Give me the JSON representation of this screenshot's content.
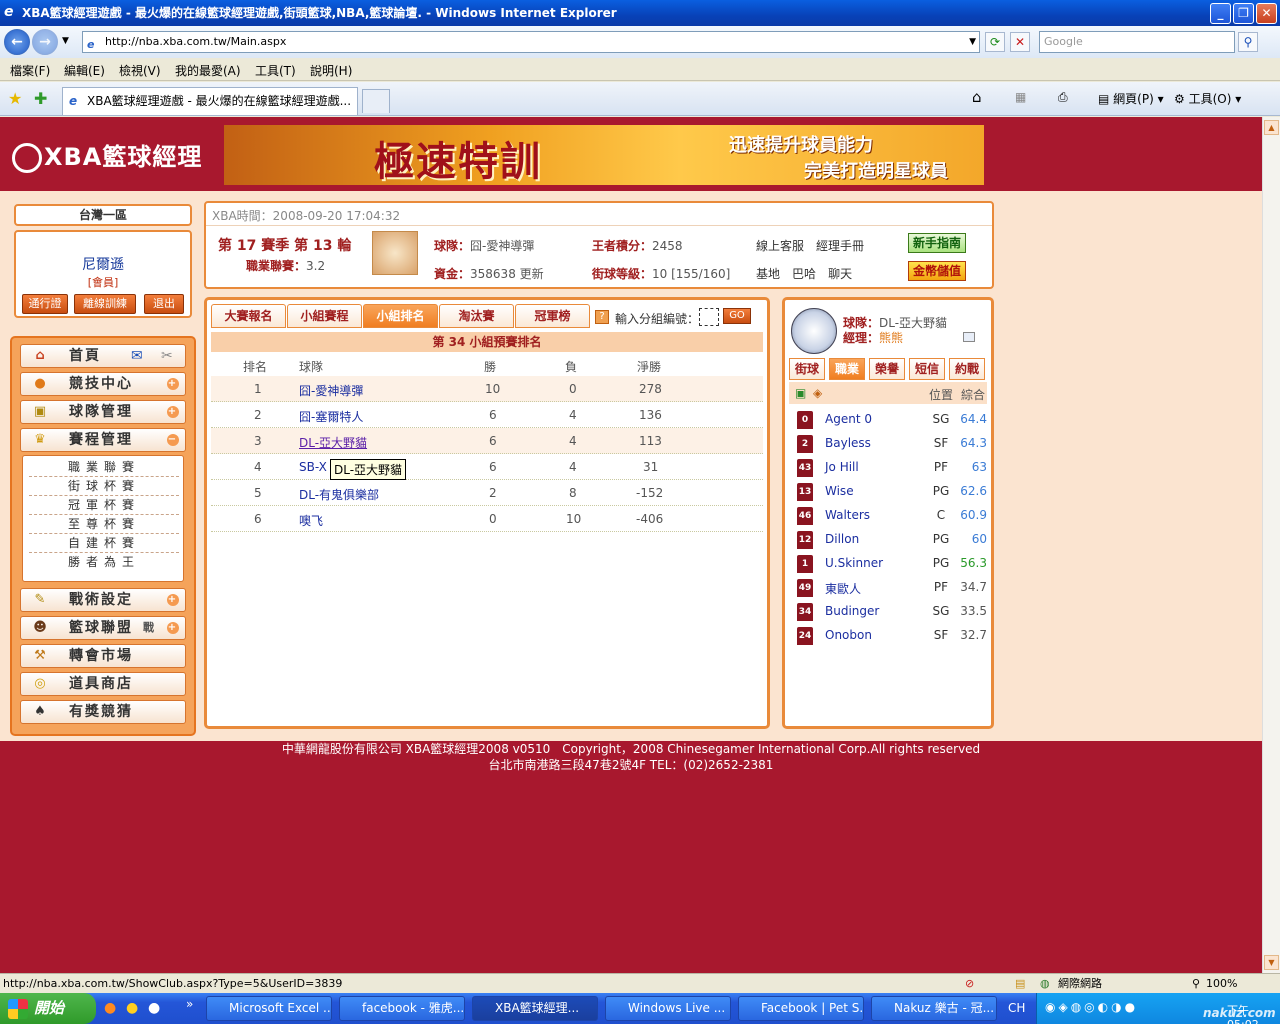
{
  "window": {
    "title": "XBA籃球經理遊戲 - 最火爆的在線籃球經理遊戲,街頭籃球,NBA,籃球論壇. - Windows Internet Explorer",
    "url": "http://nba.xba.com.tw/Main.aspx",
    "search_placeholder": "Google",
    "status_url": "http://nba.xba.com.tw/ShowClub.aspx?Type=5&UserID=3839",
    "zone": "網際網路",
    "zoom": "100%"
  },
  "menu": [
    "檔案(F)",
    "編輯(E)",
    "檢視(V)",
    "我的最愛(A)",
    "工具(T)",
    "說明(H)"
  ],
  "tab": {
    "label": "XBA籃球經理遊戲 - 最火爆的在線籃球經理遊戲..."
  },
  "toolbar": {
    "page_label": "網頁(P)",
    "tools_label": "工具(O)"
  },
  "site": {
    "logo": "XBA籃球經理",
    "ad_title": "極速特訓",
    "ad_line1": "迅速提升球員能力",
    "ad_line2": "完美打造明星球員"
  },
  "user": {
    "server": "台灣一區",
    "name": "尼爾遜",
    "role": "[會員]",
    "buttons": [
      "通行證",
      "離線訓練",
      "退出"
    ]
  },
  "nav": {
    "home": "首頁",
    "items": [
      "競技中心",
      "球隊管理",
      "賽程管理",
      "戰術設定",
      "籃球聯盟",
      "轉會市場",
      "道具商店",
      "有獎競猜"
    ],
    "league_tag": "戰",
    "sub": [
      "職業聯賽",
      "街球杯賽",
      "冠軍杯賽",
      "至尊杯賽",
      "自建杯賽",
      "勝者為王"
    ]
  },
  "info": {
    "time_label": "XBA時間：",
    "time": "2008-09-20 17:04:32",
    "season": "第 17 賽季 第 13 輪",
    "league_label": "職業聯賽：",
    "league": "3.2",
    "team_label": "球隊：",
    "team": "囧-愛神導彈",
    "points_label": "王者積分：",
    "points": "2458",
    "funds_label": "資金：",
    "funds": "358638",
    "update": "更新",
    "level_label": "街球等級：",
    "level": "10 [155/160]",
    "service": "線上客服",
    "manual": "經理手冊",
    "base": "基地",
    "baha": "巴哈",
    "chat": "聊天",
    "guide_btn": "新手指南",
    "gold_btn": "金幣儲值"
  },
  "center": {
    "tabs": [
      "大賽報名",
      "小組賽程",
      "小組排名",
      "淘汰賽",
      "冠軍榜"
    ],
    "input_label": "輸入分組編號：",
    "go": "GO",
    "group_title": "第 34 小組預賽排名",
    "headers": [
      "排名",
      "球隊",
      "勝",
      "負",
      "淨勝"
    ],
    "rows": [
      {
        "rank": "1",
        "team": "囧-愛神導彈",
        "w": "10",
        "l": "0",
        "diff": "278"
      },
      {
        "rank": "2",
        "team": "囧-塞爾特人",
        "w": "6",
        "l": "4",
        "diff": "136"
      },
      {
        "rank": "3",
        "team": "DL-亞大野貓",
        "w": "6",
        "l": "4",
        "diff": "113"
      },
      {
        "rank": "4",
        "team": "SB-X",
        "w": "6",
        "l": "4",
        "diff": "31"
      },
      {
        "rank": "5",
        "team": "DL-有鬼俱樂部",
        "w": "2",
        "l": "8",
        "diff": "-152"
      },
      {
        "rank": "6",
        "team": "噢飞",
        "w": "0",
        "l": "10",
        "diff": "-406"
      }
    ],
    "tooltip": "DL-亞大野貓"
  },
  "right": {
    "team_label": "球隊：",
    "team": "DL-亞大野貓",
    "manager_label": "經理：",
    "manager": "熊熊",
    "tabs": [
      "街球",
      "職業",
      "榮譽",
      "短信",
      "約戰"
    ],
    "col_pos": "位置",
    "col_ovr": "綜合",
    "players": [
      {
        "num": "0",
        "name": "Agent 0",
        "pos": "SG",
        "ovr": "64.4",
        "color": "#3a7bd5"
      },
      {
        "num": "2",
        "name": "Bayless",
        "pos": "SF",
        "ovr": "64.3",
        "color": "#3a7bd5"
      },
      {
        "num": "43",
        "name": "Jo Hill",
        "pos": "PF",
        "ovr": "63",
        "color": "#3a7bd5"
      },
      {
        "num": "13",
        "name": "Wise",
        "pos": "PG",
        "ovr": "62.6",
        "color": "#3a7bd5"
      },
      {
        "num": "46",
        "name": "Walters",
        "pos": "C",
        "ovr": "60.9",
        "color": "#3a7bd5"
      },
      {
        "num": "12",
        "name": "Dillon",
        "pos": "PG",
        "ovr": "60",
        "color": "#3a7bd5"
      },
      {
        "num": "1",
        "name": "U.Skinner",
        "pos": "PG",
        "ovr": "56.3",
        "color": "#2a9a2a"
      },
      {
        "num": "49",
        "name": "東歐人",
        "pos": "PF",
        "ovr": "34.7",
        "color": "#555555"
      },
      {
        "num": "34",
        "name": "Budinger",
        "pos": "SG",
        "ovr": "33.5",
        "color": "#555555"
      },
      {
        "num": "24",
        "name": "Onobon",
        "pos": "SF",
        "ovr": "32.7",
        "color": "#555555"
      }
    ]
  },
  "footer": {
    "line1": "中華網龍股份有限公司 XBA籃球經理2008 v0510　Copyright，2008 Chinesegamer International Corp.All rights reserved",
    "line2": "台北市南港路三段47巷2號4F TEL：(02)2652-2381"
  },
  "taskbar": {
    "start": "開始",
    "tasks": [
      "Microsoft Excel ...",
      "facebook - 雅虎...",
      "XBA籃球經理...",
      "Windows Live ...",
      "Facebook | Pet S...",
      "Nakuz 樂古 - 冠..."
    ],
    "lang": "CH",
    "clock": "下午 05:02",
    "watermark": "nakuz.com"
  }
}
